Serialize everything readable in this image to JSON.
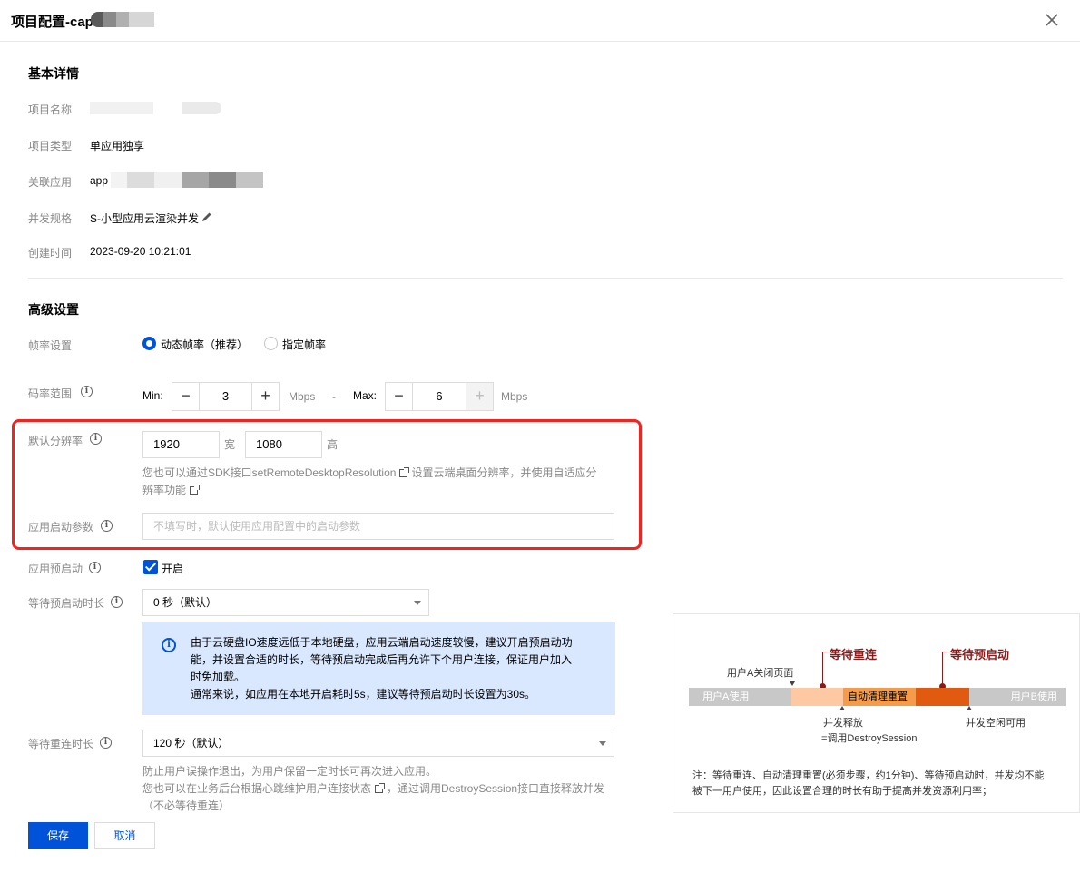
{
  "dialog": {
    "title": "项目配置-cap",
    "title_mask_colors": [
      "#5a5a5a",
      "#8a8a8a",
      "#b0b0b0",
      "#d6d6d6"
    ]
  },
  "basic": {
    "section_title": "基本详情",
    "project_name_label": "项目名称",
    "project_type_label": "项目类型",
    "project_type_value": "单应用独享",
    "linked_app_label": "关联应用",
    "linked_app_value": "app",
    "concurrency_label": "并发规格",
    "concurrency_value": "S-小型应用云渲染并发",
    "created_label": "创建时间",
    "created_value": "2023-09-20 10:21:01"
  },
  "advanced": {
    "section_title": "高级设置",
    "frame_rate_label": "帧率设置",
    "frame_rate_options": [
      "动态帧率（推荐）",
      "指定帧率"
    ],
    "frame_rate_selected": 0,
    "bitrate_label": "码率范围",
    "min_label": "Min:",
    "min_value": "3",
    "max_label": "Max:",
    "max_value": "6",
    "unit": "Mbps",
    "range_sep": "-",
    "resolution_label": "默认分辨率",
    "width_value": "1920",
    "width_unit": "宽",
    "height_value": "1080",
    "height_unit": "高",
    "resolution_hint_a": "您也可以通过SDK接口setRemoteDesktopResolution",
    "resolution_hint_b": "设置云端桌面分辨率，并使用自适应分",
    "resolution_hint_c": "辨率功能",
    "launch_params_label": "应用启动参数",
    "launch_params_placeholder": "不填写时，默认使用应用配置中的启动参数",
    "prestart_label": "应用预启动",
    "prestart_checked": true,
    "prestart_text": "开启",
    "prestart_wait_label": "等待预启动时长",
    "prestart_wait_value": "0 秒（默认）",
    "notice_lines": [
      "由于云硬盘IO速度远低于本地硬盘，应用云端启动速度较慢，建议开启预启动功",
      "能，并设置合适的时长，等待预启动完成后再允许下个用户连接，保证用户加入",
      "时免加载。",
      "通常来说，如应用在本地开启耗时5s，建议等待预启动时长设置为30s。"
    ],
    "reconnect_label": "等待重连时长",
    "reconnect_value": "120 秒（默认）",
    "reconnect_hint_a": "防止用户误操作退出，为用户保留一定时长可再次进入应用。",
    "reconnect_hint_b": "您也可以在业务后台根据心跳维护用户连接状态",
    "reconnect_hint_c": "，通过调用DestroySession接口直接释放并发",
    "reconnect_hint_d": "（不必等待重连）"
  },
  "buttons": {
    "save": "保存",
    "cancel": "取消"
  },
  "diagram": {
    "wait_reconnect": "等待重连",
    "wait_prestart": "等待预启动",
    "user_a_close": "用户A关闭页面",
    "seg_user_a": "用户A使用",
    "seg_auto_clean": "自动清理重置",
    "seg_user_b": "用户B使用",
    "release_line1": "并发释放",
    "release_line2": "=调用DestroySession",
    "idle_available": "并发空闲可用",
    "note_line1": "注：等待重连、自动清理重置(必须步骤，约1分钟)、等待预启动时，并发均不能",
    "note_line2": "被下一用户使用，因此设置合理的时长有助于提高并发资源利用率；",
    "colors": {
      "gray": "#c8c8c8",
      "light_orange": "#fcc9a3",
      "orange": "#f59b4c",
      "dark_orange": "#e05a10",
      "marker": "#8b1a1a"
    }
  },
  "colors": {
    "accent": "#0052d9",
    "highlight_border": "#f5221d",
    "notice_bg": "#d9e8ff"
  }
}
